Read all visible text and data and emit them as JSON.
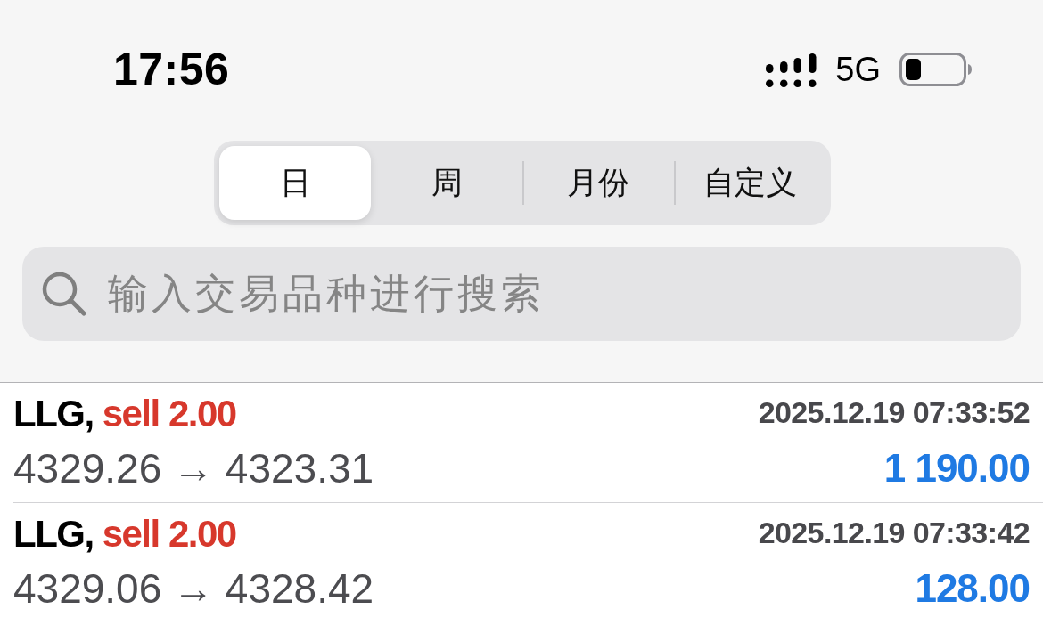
{
  "status_bar": {
    "time": "17:56",
    "network": "5G"
  },
  "period_tabs": [
    {
      "label": "日",
      "selected": true
    },
    {
      "label": "周",
      "selected": false
    },
    {
      "label": "月份",
      "selected": false
    },
    {
      "label": "自定义",
      "selected": false
    }
  ],
  "search": {
    "placeholder": "输入交易品种进行搜索"
  },
  "trades": [
    {
      "symbol": "LLG,",
      "order": "sell 2.00",
      "time": "2025.12.19 07:33:52",
      "prices": "4329.26 → 4323.31",
      "profit": "1 190.00"
    },
    {
      "symbol": "LLG,",
      "order": "sell 2.00",
      "time": "2025.12.19 07:33:42",
      "prices": "4329.06 → 4328.42",
      "profit": "128.00"
    }
  ]
}
